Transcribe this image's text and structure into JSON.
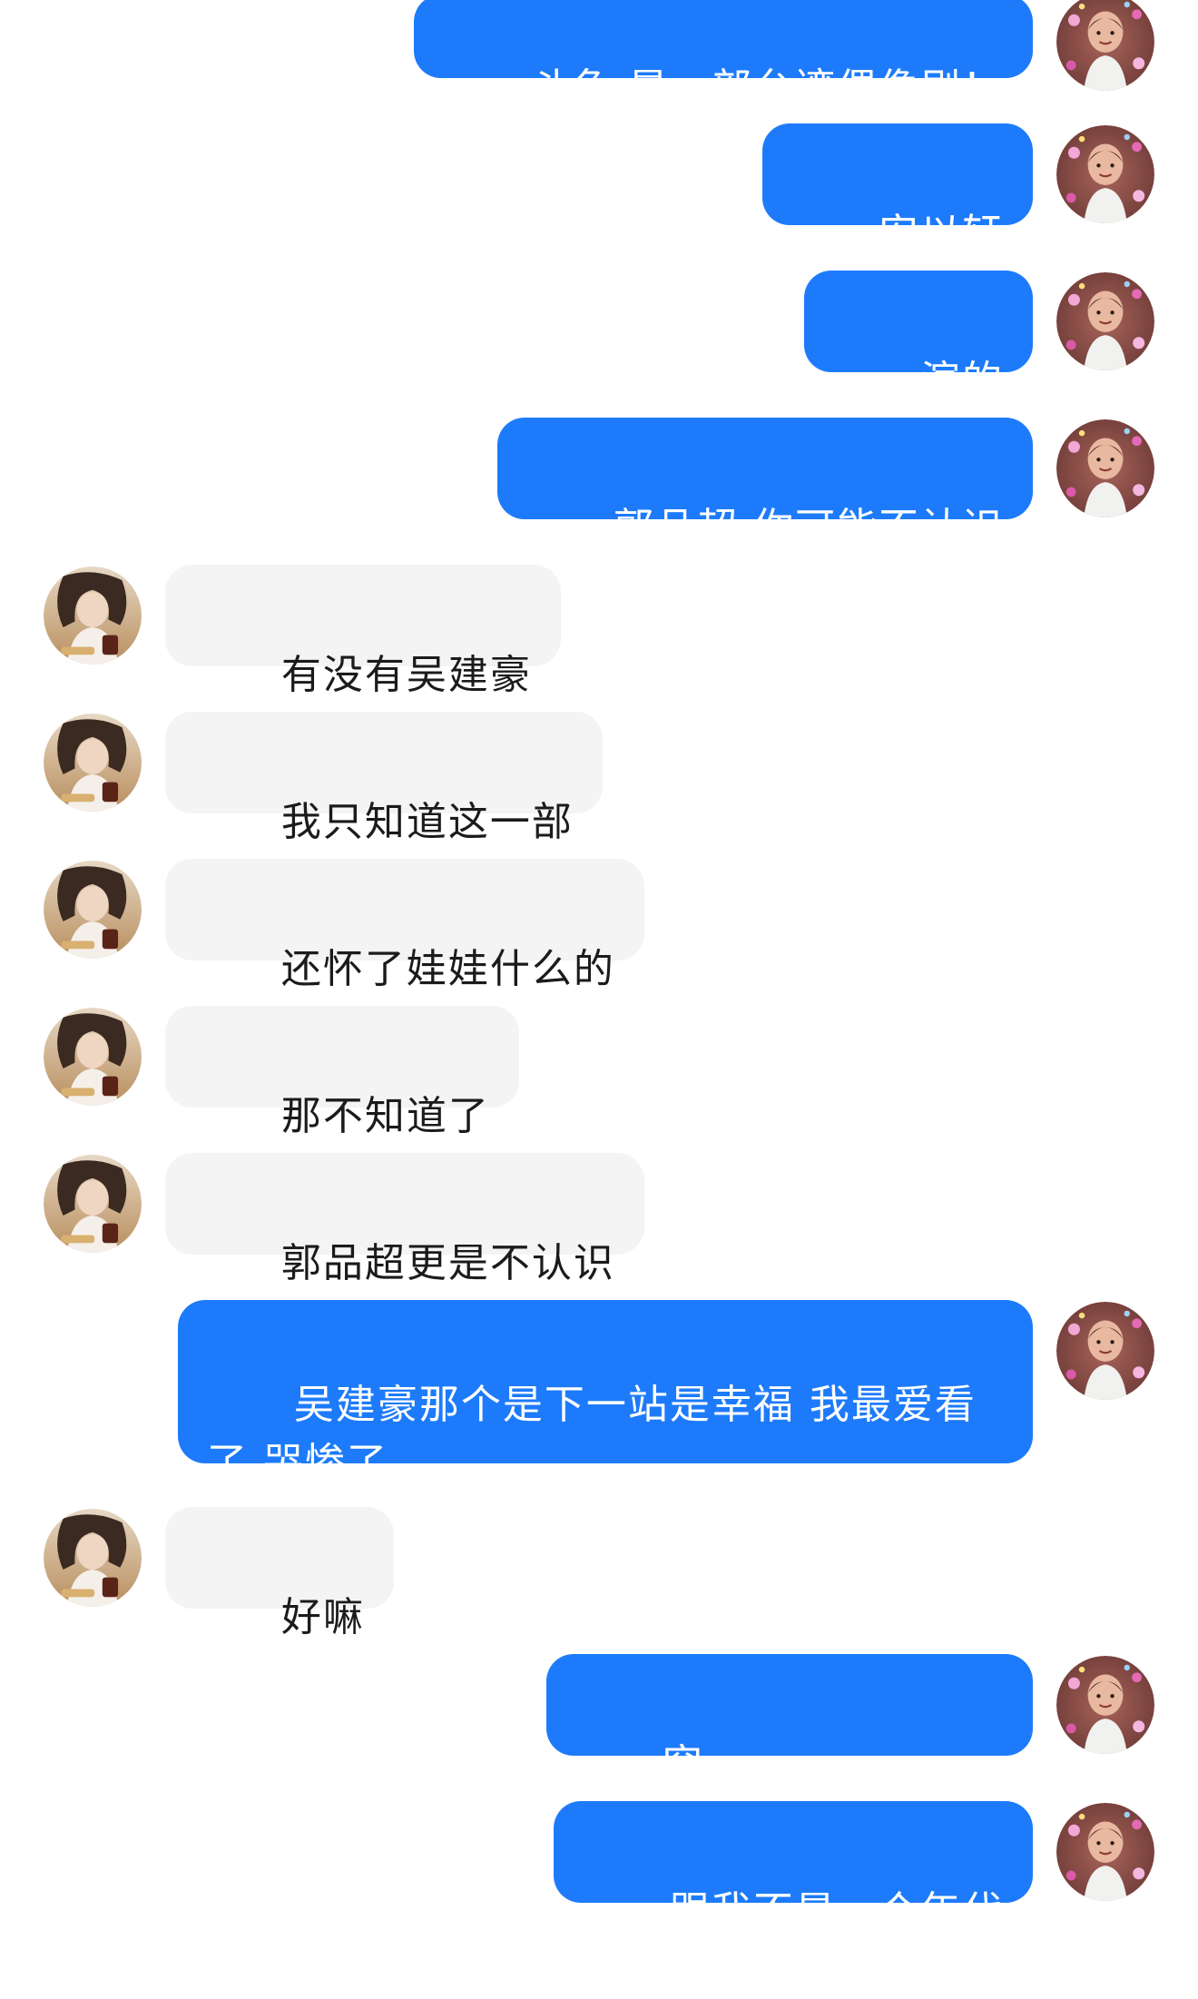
{
  "messages": [
    {
      "from": "me",
      "text": "斗鱼 是一部台湾偶像剧！"
    },
    {
      "from": "me",
      "text": "安以轩"
    },
    {
      "from": "me",
      "text": "演的"
    },
    {
      "from": "me",
      "text": "郭品超 你可能不认识"
    },
    {
      "from": "other",
      "text": "有没有吴建豪"
    },
    {
      "from": "other",
      "text": "我只知道这一部"
    },
    {
      "from": "other",
      "text": "还怀了娃娃什么的"
    },
    {
      "from": "other",
      "text": "那不知道了"
    },
    {
      "from": "other",
      "text": "郭品超更是不认识"
    },
    {
      "from": "me",
      "text": "吴建豪那个是下一站是幸福 我最爱看了 哭惨了"
    },
    {
      "from": "other",
      "text": "好嘛"
    },
    {
      "from": "me",
      "text": "突"
    },
    {
      "from": "me",
      "text": "跟我不是一个年代"
    }
  ],
  "colors": {
    "me_bubble": "#1d7bfb",
    "other_bubble": "#f4f4f4",
    "me_text": "#ffffff",
    "other_text": "#1b1b1b"
  },
  "icons": {
    "me_avatar": "child-photo-avatar",
    "other_avatar": "woman-photo-avatar"
  }
}
